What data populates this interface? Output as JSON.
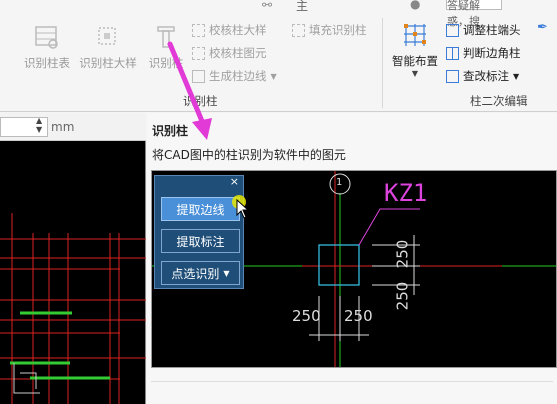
{
  "topbar": {
    "fragment": "主",
    "search_hint": "答疑解惑，搜"
  },
  "ribbon": {
    "group1": {
      "buttons": [
        {
          "label": "识别柱表"
        },
        {
          "label": "识别柱大样"
        },
        {
          "label": "识别柱"
        }
      ],
      "small": [
        {
          "label": "校核柱大样"
        },
        {
          "label": "校核柱图元"
        },
        {
          "label": "生成柱边线"
        }
      ],
      "fill": {
        "label": "填充识别柱"
      },
      "group_label": "识别柱"
    },
    "group2": {
      "smart": {
        "label": "智能布置"
      },
      "small": [
        {
          "label": "调整柱端头"
        },
        {
          "label": "判断边角柱"
        },
        {
          "label": "查改标注"
        }
      ],
      "group_label": "柱二次编辑"
    }
  },
  "left": {
    "unit": "mm"
  },
  "panel": {
    "title": "识别柱",
    "description": "将CAD图中的柱识别为软件中的图元"
  },
  "float_tool": {
    "close": "×",
    "buttons": [
      {
        "label": "提取边线"
      },
      {
        "label": "提取标注"
      },
      {
        "label": "点选识别"
      }
    ]
  },
  "cad": {
    "axis_label": "1",
    "column_label": "KZ1",
    "dims": {
      "a": "250",
      "b": "250",
      "c": "250",
      "d": "250"
    }
  },
  "colors": {
    "accent": "#4a90d9",
    "tool_bg": "#1f4e78",
    "arrow": "#e23ad6"
  }
}
